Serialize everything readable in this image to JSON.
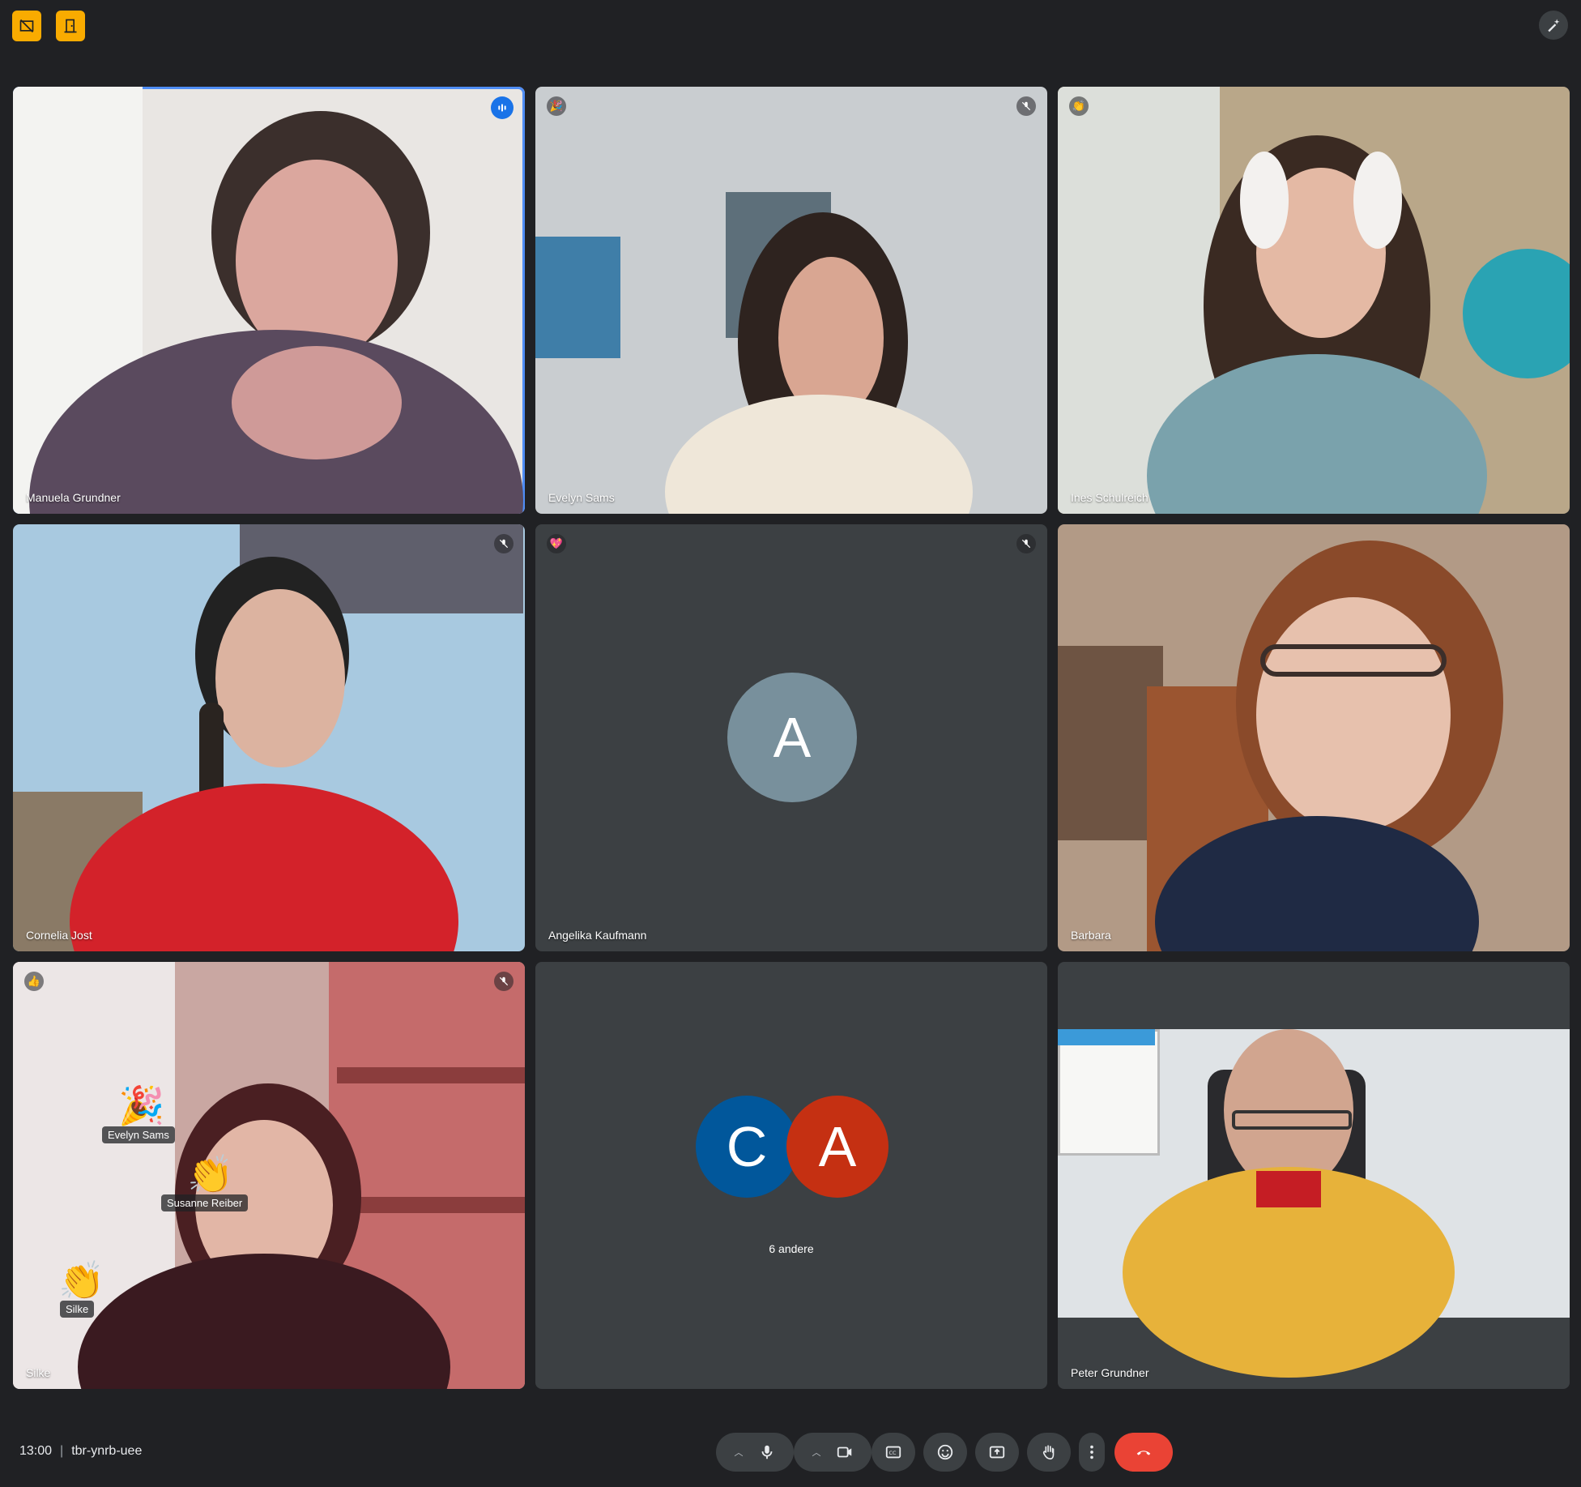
{
  "top": {
    "left_buttons": [
      "host-controls-icon",
      "door-icon"
    ],
    "right_button": "pencil-sparkle-icon"
  },
  "participants": [
    {
      "name": "Manuela Grundner",
      "status": "speaking",
      "reaction": "",
      "active": true
    },
    {
      "name": "Evelyn Sams",
      "status": "muted",
      "reaction": "🎉"
    },
    {
      "name": "Ines Schulreich",
      "status": "",
      "reaction": "👏"
    },
    {
      "name": "Cornelia Jost",
      "status": "muted",
      "reaction": ""
    },
    {
      "name": "Angelika Kaufmann",
      "status": "muted",
      "reaction": "💖",
      "avatar": "A",
      "avatar_color": "#78909c"
    },
    {
      "name": "Barbara",
      "status": "",
      "reaction": ""
    },
    {
      "name": "Silke",
      "status": "muted",
      "reaction": "👍"
    },
    {
      "name": "6 andere",
      "avatars": [
        "C",
        "A"
      ],
      "avatar_colors": [
        "#01579b",
        "#c53012"
      ]
    },
    {
      "name": "Peter Grundner",
      "status": "",
      "reaction": ""
    }
  ],
  "floating_reactions": [
    {
      "emoji": "🎉",
      "name": "Evelyn Sams"
    },
    {
      "emoji": "👏",
      "name": "Susanne Reiber"
    },
    {
      "emoji": "👏",
      "name": "Silke"
    }
  ],
  "meeting": {
    "time": "13:00",
    "code": "tbr-ynrb-uee"
  },
  "controls": [
    "mic",
    "camera",
    "captions",
    "emoji",
    "present",
    "raise-hand",
    "more",
    "end-call"
  ]
}
